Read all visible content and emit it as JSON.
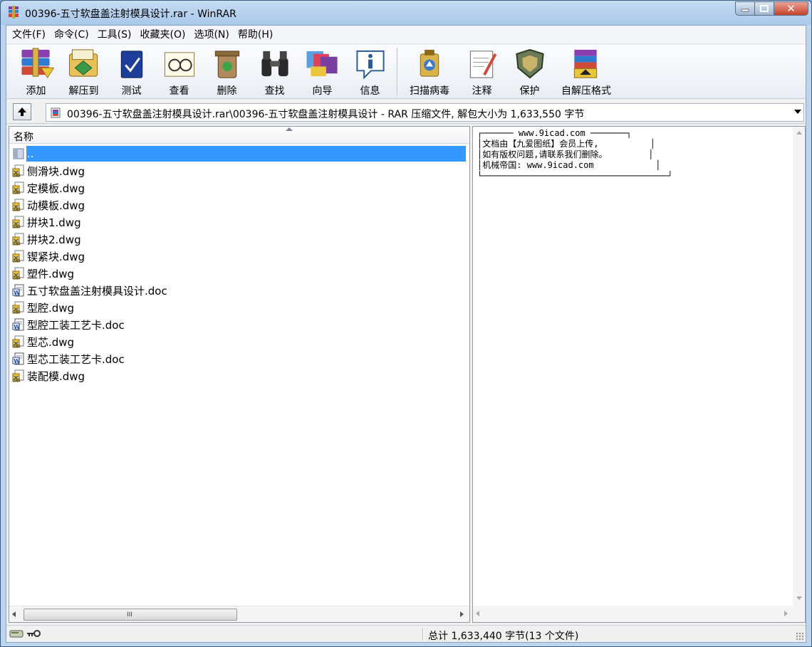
{
  "window": {
    "title": "00396-五寸软盘盖注射模具设计.rar - WinRAR",
    "minimize": "",
    "maximize": "",
    "close": "✕"
  },
  "menu": [
    "文件(F)",
    "命令(C)",
    "工具(S)",
    "收藏夹(O)",
    "选项(N)",
    "帮助(H)"
  ],
  "toolbar": {
    "buttons": [
      {
        "label": "添加",
        "icon": "add-archive-icon"
      },
      {
        "label": "解压到",
        "icon": "extract-to-icon"
      },
      {
        "label": "测试",
        "icon": "test-icon"
      },
      {
        "label": "查看",
        "icon": "view-icon"
      },
      {
        "label": "删除",
        "icon": "delete-icon"
      },
      {
        "label": "查找",
        "icon": "find-icon"
      },
      {
        "label": "向导",
        "icon": "wizard-icon"
      },
      {
        "label": "信息",
        "icon": "info-icon"
      },
      {
        "label": "扫描病毒",
        "icon": "virus-scan-icon"
      },
      {
        "label": "注释",
        "icon": "comment-icon"
      },
      {
        "label": "保护",
        "icon": "protect-icon"
      },
      {
        "label": "自解压格式",
        "icon": "sfx-icon"
      }
    ]
  },
  "address": {
    "path": "00396-五寸软盘盖注射模具设计.rar\\00396-五寸软盘盖注射模具设计 - RAR 压缩文件, 解包大小为 1,633,550 字节"
  },
  "filelist": {
    "column_name": "名称",
    "items": [
      {
        "name": "..",
        "type": "parent",
        "selected": true
      },
      {
        "name": "侧滑块.dwg",
        "type": "dwg"
      },
      {
        "name": "定模板.dwg",
        "type": "dwg"
      },
      {
        "name": "动模板.dwg",
        "type": "dwg"
      },
      {
        "name": "拼块1.dwg",
        "type": "dwg"
      },
      {
        "name": "拼块2.dwg",
        "type": "dwg"
      },
      {
        "name": "锲紧块.dwg",
        "type": "dwg"
      },
      {
        "name": "塑件.dwg",
        "type": "dwg"
      },
      {
        "name": "五寸软盘盖注射模具设计.doc",
        "type": "doc"
      },
      {
        "name": "型腔.dwg",
        "type": "dwg"
      },
      {
        "name": "型腔工装工艺卡.doc",
        "type": "doc"
      },
      {
        "name": "型芯.dwg",
        "type": "dwg"
      },
      {
        "name": "型芯工装工艺卡.doc",
        "type": "doc"
      },
      {
        "name": "装配模.dwg",
        "type": "dwg"
      }
    ],
    "scroll_grip": "III"
  },
  "comment": {
    "text": "┌────── www.9icad.com ───────┐\n│文档由【九爱图纸】会员上传,          │\n│如有版权问题,请联系我们删除。        │\n│机械帝国: www.9icad.com            │\n└────────────────────────────────────┘"
  },
  "status": {
    "text": "总计 1,633,440 字节(13 个文件)"
  },
  "colors": {
    "selection": "#3399ff",
    "title_gradient_top": "#c6dcf3",
    "close_button": "#c8422b"
  }
}
